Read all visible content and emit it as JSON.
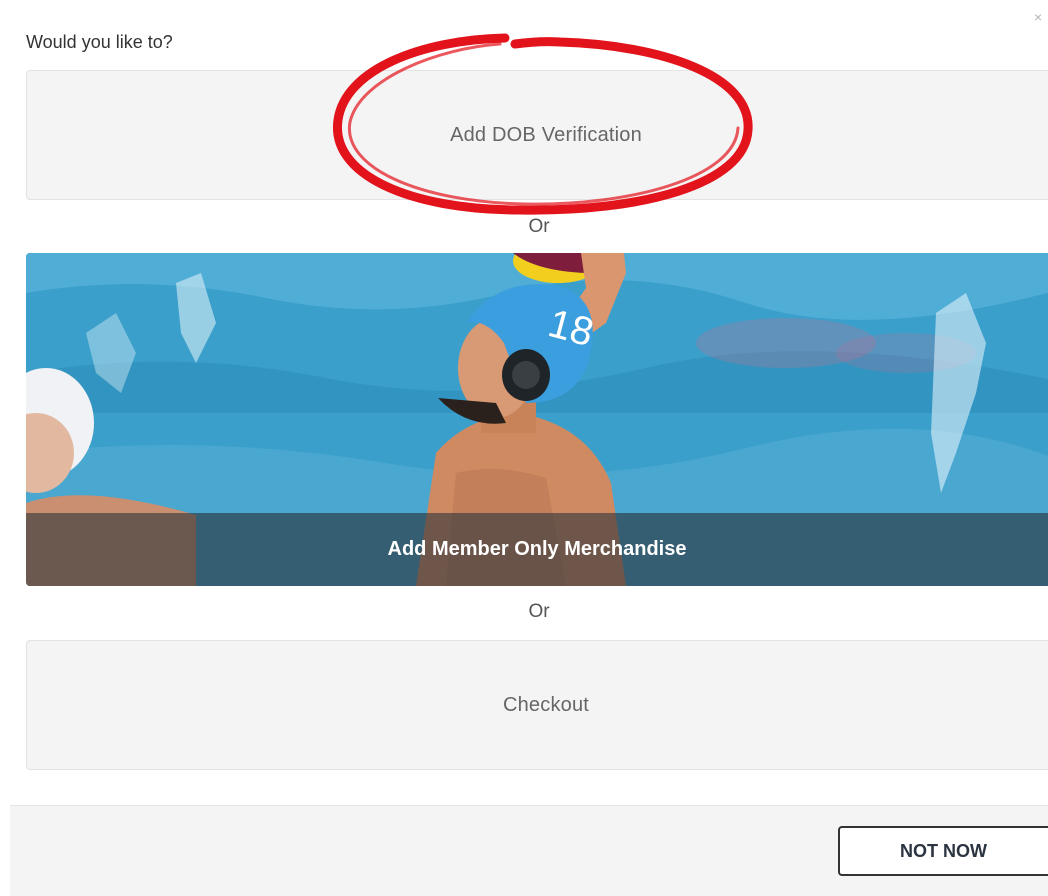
{
  "dialog": {
    "prompt": "Would you like to?",
    "close_glyph": "×"
  },
  "options": {
    "dob_label": "Add DOB Verification",
    "separator_1": "Or",
    "merch_label": "Add Member Only Merchandise",
    "merch_cap_number": "18",
    "separator_2": "Or",
    "checkout_label": "Checkout"
  },
  "footer": {
    "not_now_label": "NOT NOW"
  },
  "colors": {
    "annotation": "#e3131b",
    "tile_background": "#f4f4f4"
  }
}
